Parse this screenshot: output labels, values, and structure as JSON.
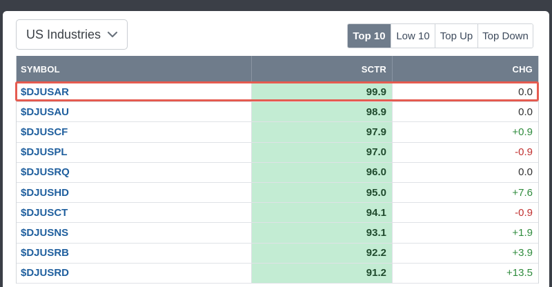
{
  "dropdown": {
    "selected": "US Industries",
    "icon": "chevron-down-icon"
  },
  "tabs": [
    {
      "label": "Top 10",
      "active": true
    },
    {
      "label": "Low 10",
      "active": false
    },
    {
      "label": "Top Up",
      "active": false
    },
    {
      "label": "Top Down",
      "active": false
    }
  ],
  "table": {
    "headers": {
      "symbol": "SYMBOL",
      "sctr": "SCTR",
      "chg": "CHG"
    },
    "rows": [
      {
        "symbol": "$DJUSAR",
        "sctr": "99.9",
        "chg": "0.0",
        "highlighted": true
      },
      {
        "symbol": "$DJUSAU",
        "sctr": "98.9",
        "chg": "0.0"
      },
      {
        "symbol": "$DJUSCF",
        "sctr": "97.9",
        "chg": "+0.9"
      },
      {
        "symbol": "$DJUSPL",
        "sctr": "97.0",
        "chg": "-0.9"
      },
      {
        "symbol": "$DJUSRQ",
        "sctr": "96.0",
        "chg": "0.0"
      },
      {
        "symbol": "$DJUSHD",
        "sctr": "95.0",
        "chg": "+7.6"
      },
      {
        "symbol": "$DJUSCT",
        "sctr": "94.1",
        "chg": "-0.9"
      },
      {
        "symbol": "$DJUSNS",
        "sctr": "93.1",
        "chg": "+1.9"
      },
      {
        "symbol": "$DJUSRB",
        "sctr": "92.2",
        "chg": "+3.9"
      },
      {
        "symbol": "$DJUSRD",
        "sctr": "91.2",
        "chg": "+13.5"
      }
    ]
  },
  "colors": {
    "header_bg": "#6f7c8b",
    "sctr_bg": "#c3ecd3",
    "positive": "#2e8b3c",
    "negative": "#c0302f",
    "highlight_border": "#e55b50",
    "symbol_link": "#1f5f9e"
  }
}
